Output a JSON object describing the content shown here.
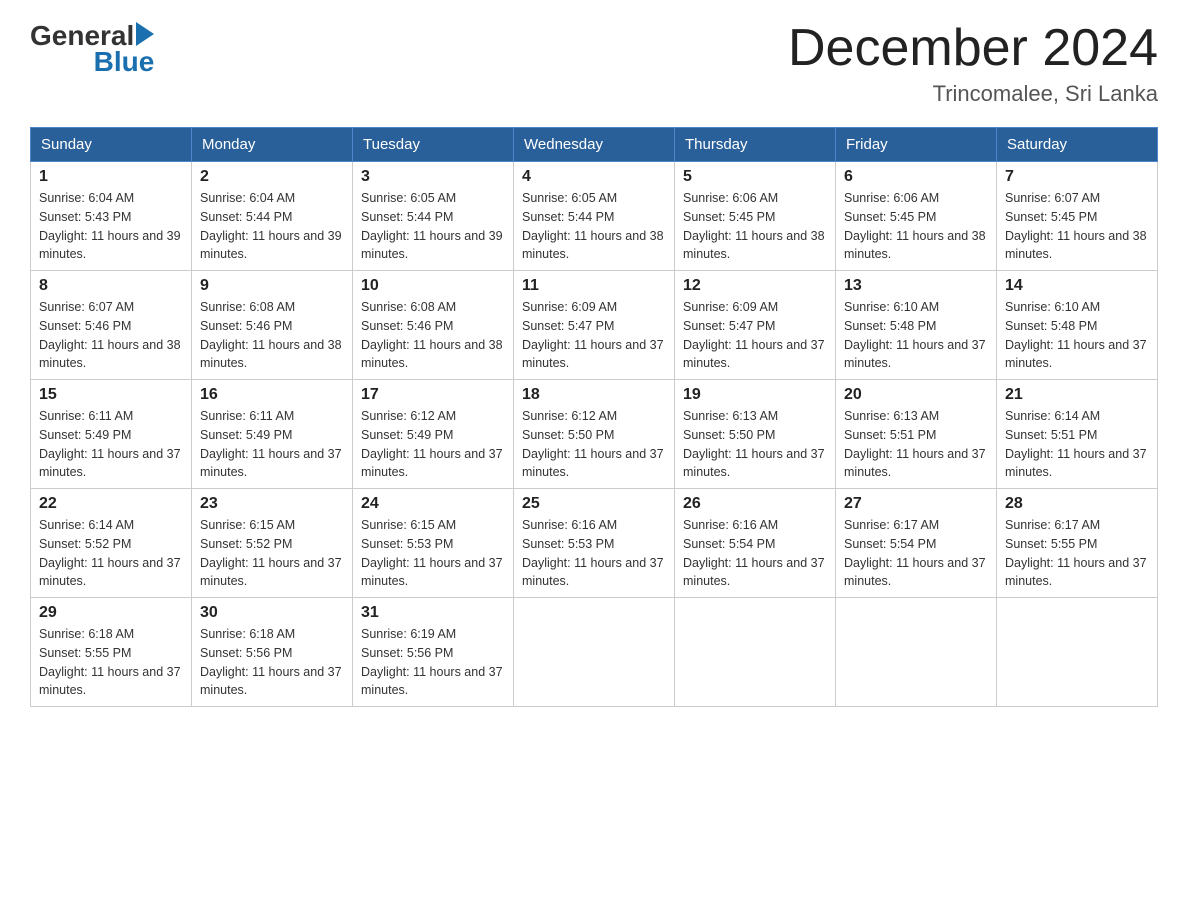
{
  "logo": {
    "general": "General",
    "arrow_color": "#1a6fae",
    "blue": "Blue"
  },
  "title": "December 2024",
  "subtitle": "Trincomalee, Sri Lanka",
  "days_of_week": [
    "Sunday",
    "Monday",
    "Tuesday",
    "Wednesday",
    "Thursday",
    "Friday",
    "Saturday"
  ],
  "weeks": [
    [
      {
        "day": "1",
        "sunrise": "6:04 AM",
        "sunset": "5:43 PM",
        "daylight": "11 hours and 39 minutes."
      },
      {
        "day": "2",
        "sunrise": "6:04 AM",
        "sunset": "5:44 PM",
        "daylight": "11 hours and 39 minutes."
      },
      {
        "day": "3",
        "sunrise": "6:05 AM",
        "sunset": "5:44 PM",
        "daylight": "11 hours and 39 minutes."
      },
      {
        "day": "4",
        "sunrise": "6:05 AM",
        "sunset": "5:44 PM",
        "daylight": "11 hours and 38 minutes."
      },
      {
        "day": "5",
        "sunrise": "6:06 AM",
        "sunset": "5:45 PM",
        "daylight": "11 hours and 38 minutes."
      },
      {
        "day": "6",
        "sunrise": "6:06 AM",
        "sunset": "5:45 PM",
        "daylight": "11 hours and 38 minutes."
      },
      {
        "day": "7",
        "sunrise": "6:07 AM",
        "sunset": "5:45 PM",
        "daylight": "11 hours and 38 minutes."
      }
    ],
    [
      {
        "day": "8",
        "sunrise": "6:07 AM",
        "sunset": "5:46 PM",
        "daylight": "11 hours and 38 minutes."
      },
      {
        "day": "9",
        "sunrise": "6:08 AM",
        "sunset": "5:46 PM",
        "daylight": "11 hours and 38 minutes."
      },
      {
        "day": "10",
        "sunrise": "6:08 AM",
        "sunset": "5:46 PM",
        "daylight": "11 hours and 38 minutes."
      },
      {
        "day": "11",
        "sunrise": "6:09 AM",
        "sunset": "5:47 PM",
        "daylight": "11 hours and 37 minutes."
      },
      {
        "day": "12",
        "sunrise": "6:09 AM",
        "sunset": "5:47 PM",
        "daylight": "11 hours and 37 minutes."
      },
      {
        "day": "13",
        "sunrise": "6:10 AM",
        "sunset": "5:48 PM",
        "daylight": "11 hours and 37 minutes."
      },
      {
        "day": "14",
        "sunrise": "6:10 AM",
        "sunset": "5:48 PM",
        "daylight": "11 hours and 37 minutes."
      }
    ],
    [
      {
        "day": "15",
        "sunrise": "6:11 AM",
        "sunset": "5:49 PM",
        "daylight": "11 hours and 37 minutes."
      },
      {
        "day": "16",
        "sunrise": "6:11 AM",
        "sunset": "5:49 PM",
        "daylight": "11 hours and 37 minutes."
      },
      {
        "day": "17",
        "sunrise": "6:12 AM",
        "sunset": "5:49 PM",
        "daylight": "11 hours and 37 minutes."
      },
      {
        "day": "18",
        "sunrise": "6:12 AM",
        "sunset": "5:50 PM",
        "daylight": "11 hours and 37 minutes."
      },
      {
        "day": "19",
        "sunrise": "6:13 AM",
        "sunset": "5:50 PM",
        "daylight": "11 hours and 37 minutes."
      },
      {
        "day": "20",
        "sunrise": "6:13 AM",
        "sunset": "5:51 PM",
        "daylight": "11 hours and 37 minutes."
      },
      {
        "day": "21",
        "sunrise": "6:14 AM",
        "sunset": "5:51 PM",
        "daylight": "11 hours and 37 minutes."
      }
    ],
    [
      {
        "day": "22",
        "sunrise": "6:14 AM",
        "sunset": "5:52 PM",
        "daylight": "11 hours and 37 minutes."
      },
      {
        "day": "23",
        "sunrise": "6:15 AM",
        "sunset": "5:52 PM",
        "daylight": "11 hours and 37 minutes."
      },
      {
        "day": "24",
        "sunrise": "6:15 AM",
        "sunset": "5:53 PM",
        "daylight": "11 hours and 37 minutes."
      },
      {
        "day": "25",
        "sunrise": "6:16 AM",
        "sunset": "5:53 PM",
        "daylight": "11 hours and 37 minutes."
      },
      {
        "day": "26",
        "sunrise": "6:16 AM",
        "sunset": "5:54 PM",
        "daylight": "11 hours and 37 minutes."
      },
      {
        "day": "27",
        "sunrise": "6:17 AM",
        "sunset": "5:54 PM",
        "daylight": "11 hours and 37 minutes."
      },
      {
        "day": "28",
        "sunrise": "6:17 AM",
        "sunset": "5:55 PM",
        "daylight": "11 hours and 37 minutes."
      }
    ],
    [
      {
        "day": "29",
        "sunrise": "6:18 AM",
        "sunset": "5:55 PM",
        "daylight": "11 hours and 37 minutes."
      },
      {
        "day": "30",
        "sunrise": "6:18 AM",
        "sunset": "5:56 PM",
        "daylight": "11 hours and 37 minutes."
      },
      {
        "day": "31",
        "sunrise": "6:19 AM",
        "sunset": "5:56 PM",
        "daylight": "11 hours and 37 minutes."
      },
      null,
      null,
      null,
      null
    ]
  ]
}
